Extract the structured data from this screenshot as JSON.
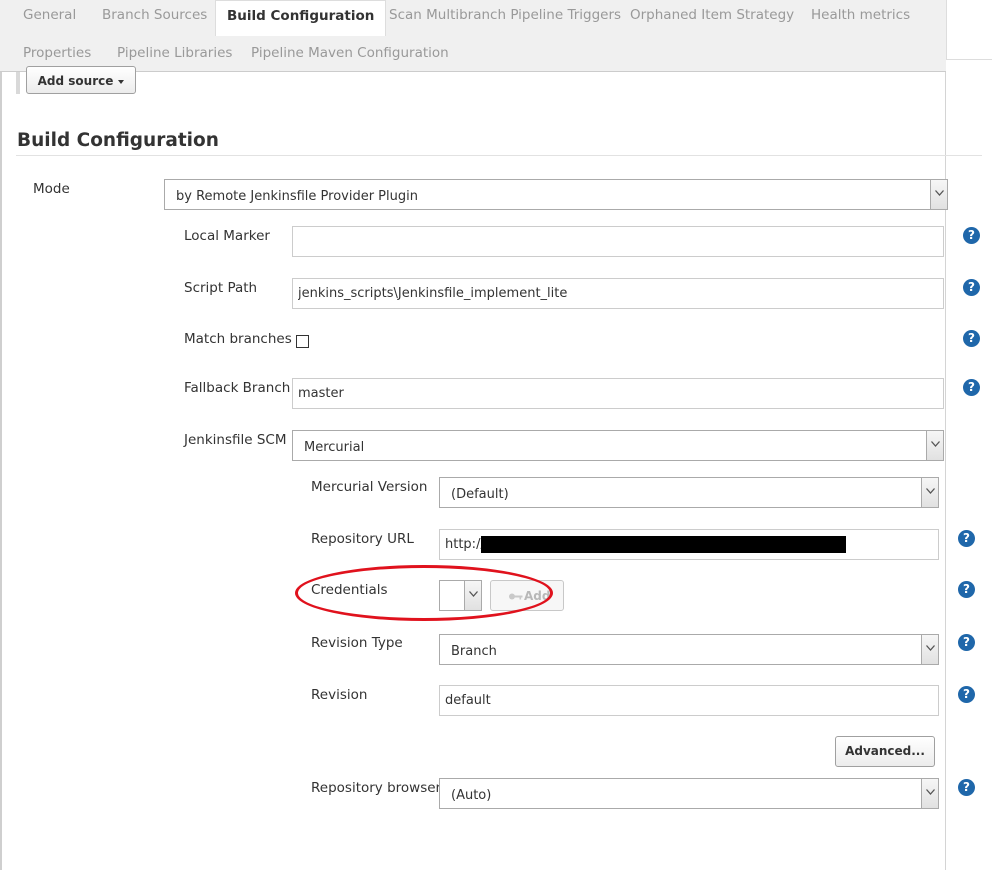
{
  "tabs": [
    {
      "label": "General",
      "active": false
    },
    {
      "label": "Branch Sources",
      "active": false
    },
    {
      "label": "Build Configuration",
      "active": true
    },
    {
      "label": "Scan Multibranch Pipeline Triggers",
      "active": false
    },
    {
      "label": "Orphaned Item Strategy",
      "active": false
    },
    {
      "label": "Health metrics",
      "active": false
    },
    {
      "label": "Properties",
      "active": false
    },
    {
      "label": "Pipeline Libraries",
      "active": false
    },
    {
      "label": "Pipeline Maven Configuration",
      "active": false
    }
  ],
  "add_source_label": "Add source",
  "section_title": "Build Configuration",
  "mode": {
    "label": "Mode",
    "value": "by Remote Jenkinsfile Provider Plugin"
  },
  "local_marker": {
    "label": "Local Marker",
    "value": ""
  },
  "script_path": {
    "label": "Script Path",
    "value": "jenkins_scripts\\Jenkinsfile_implement_lite"
  },
  "match_branches": {
    "label": "Match branches",
    "checked": false
  },
  "fallback_branch": {
    "label": "Fallback Branch",
    "value": "master"
  },
  "jenkinsfile_scm": {
    "label": "Jenkinsfile SCM",
    "value": "Mercurial"
  },
  "mercurial_version": {
    "label": "Mercurial Version",
    "value": "(Default)"
  },
  "repository_url": {
    "label": "Repository URL",
    "value": "http://"
  },
  "credentials": {
    "label": "Credentials",
    "value": "",
    "add_label": "Add"
  },
  "revision_type": {
    "label": "Revision Type",
    "value": "Branch"
  },
  "revision": {
    "label": "Revision",
    "value": "default"
  },
  "advanced_label": "Advanced...",
  "repository_browser": {
    "label": "Repository browser",
    "value": "(Auto)"
  },
  "help_icon_glyph": "?",
  "colors": {
    "help": "#1f67aa",
    "annotation": "#e0121d",
    "tab_bar": "#f0f0f0",
    "inactive_tab": "#999999"
  }
}
